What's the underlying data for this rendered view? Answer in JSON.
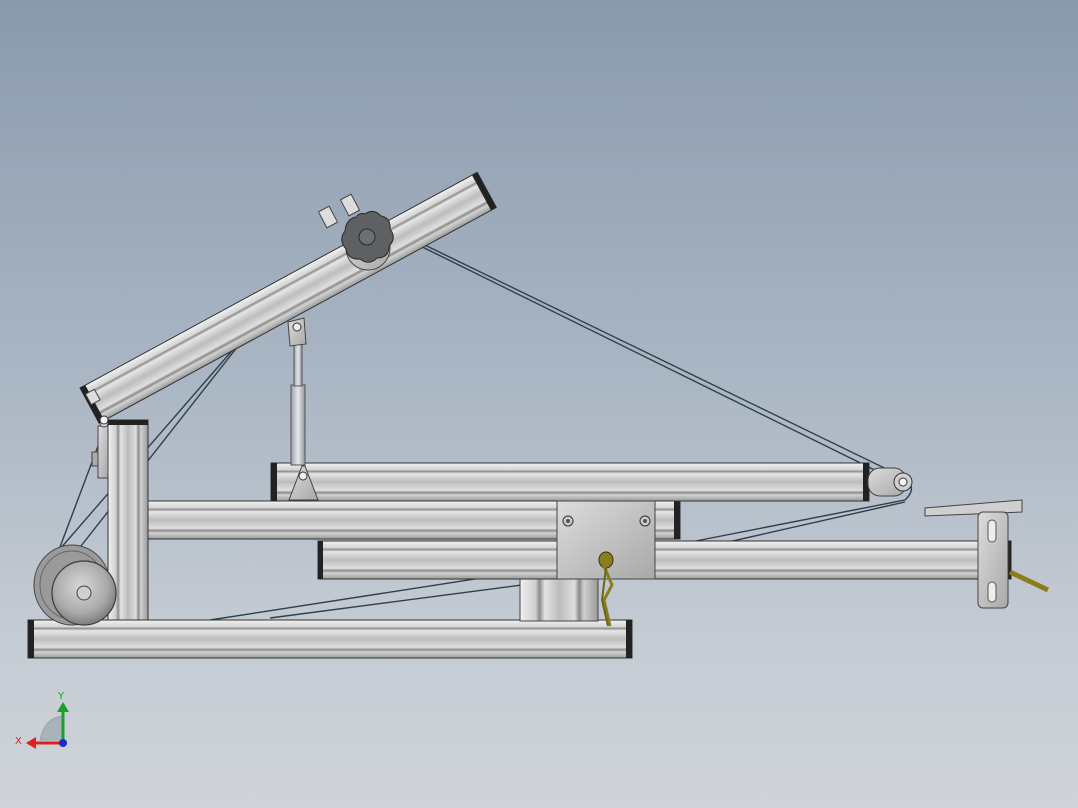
{
  "viewport": {
    "background_top": "#8a9aad",
    "background_bottom": "#cfd3d9"
  },
  "model": {
    "description_parts": [
      "aluminum-extrusion-frame",
      "tilting-arm",
      "gas-spring",
      "pulley-wheel",
      "cable",
      "star-knob",
      "locking-pin",
      "foot-pedal"
    ],
    "extrusion_color": "#c8c8c8",
    "cable_color": "#2f3f4a",
    "pin_color": "#8a7d1e",
    "knob_color": "#5e6064"
  },
  "triad": {
    "x_label": "X",
    "y_label": "Y",
    "x_color": "#e0201a",
    "y_color": "#1aa02a",
    "z_color": "#1a2ad0"
  }
}
